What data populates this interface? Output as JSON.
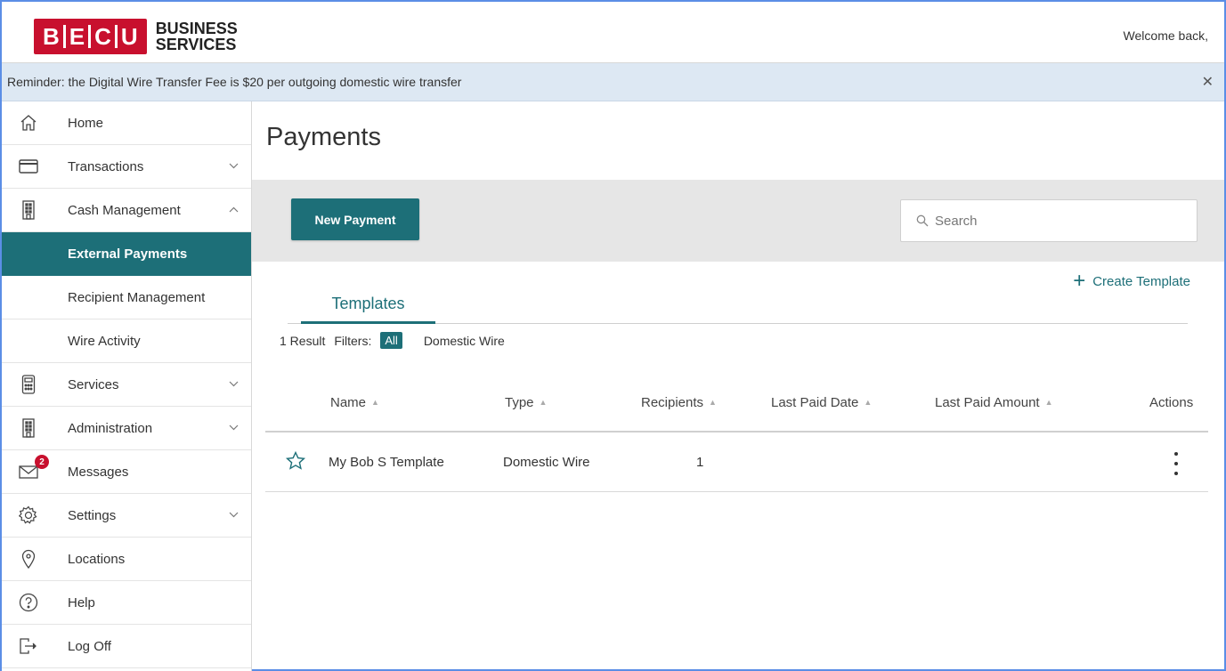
{
  "brand": {
    "logo_letters": [
      "B",
      "E",
      "C",
      "U"
    ],
    "logo_line1": "BUSINESS",
    "logo_line2": "SERVICES",
    "brand_color": "#c8102e",
    "accent_color": "#1d6f78"
  },
  "header": {
    "welcome": "Welcome back,"
  },
  "banner": {
    "text": "Reminder: the Digital Wire Transfer Fee is $20 per outgoing domestic wire transfer",
    "close_icon": "close-icon"
  },
  "sidebar": {
    "items": [
      {
        "label": "Home",
        "icon": "home-icon"
      },
      {
        "label": "Transactions",
        "icon": "card-icon",
        "expand": "chevron-down"
      },
      {
        "label": "Cash Management",
        "icon": "building-icon",
        "expand": "chevron-up"
      },
      {
        "label": "External Payments",
        "active": true
      },
      {
        "label": "Recipient Management"
      },
      {
        "label": "Wire Activity"
      },
      {
        "label": "Services",
        "icon": "calculator-icon",
        "expand": "chevron-down"
      },
      {
        "label": "Administration",
        "icon": "building-icon",
        "expand": "chevron-down"
      },
      {
        "label": "Messages",
        "icon": "mail-icon",
        "badge": "2"
      },
      {
        "label": "Settings",
        "icon": "gear-icon",
        "expand": "chevron-down"
      },
      {
        "label": "Locations",
        "icon": "location-icon"
      },
      {
        "label": "Help",
        "icon": "help-icon"
      },
      {
        "label": "Log Off",
        "icon": "logout-icon"
      }
    ]
  },
  "main": {
    "title": "Payments",
    "new_payment": "New Payment",
    "search_placeholder": "Search",
    "create_template": "Create Template",
    "tabs": [
      {
        "label": "Templates",
        "active": true
      }
    ],
    "result_count": "1 Result",
    "filters_label": "Filters:",
    "filters": [
      "All",
      "Domestic Wire"
    ],
    "selected_filter": "All",
    "table": {
      "columns": [
        "Name",
        "Type",
        "Recipients",
        "Last Paid Date",
        "Last Paid Amount",
        "Actions"
      ],
      "rows": [
        {
          "name": "My Bob S Template",
          "type": "Domestic Wire",
          "recipients": "1",
          "last_paid_date": "",
          "last_paid_amount": "",
          "favorite": false
        }
      ]
    }
  }
}
